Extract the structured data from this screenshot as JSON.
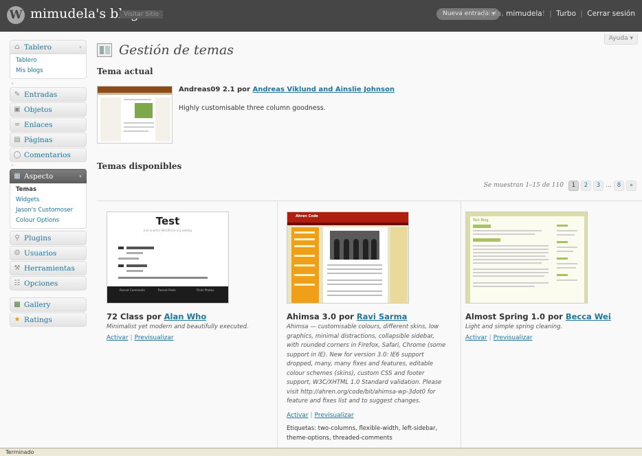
{
  "header": {
    "blog_title": "mimudela's blog",
    "visit_site": "Visitar Sitio",
    "new_entry": "Nueva entrada",
    "greeting": "¡Hola, ",
    "username": "mimudela",
    "greeting_end": "!",
    "turbo": "Turbo",
    "logout": "Cerrar sesión"
  },
  "help_tab": "Ayuda",
  "menu": {
    "tablero": "Tablero",
    "tablero_sub": [
      "Tablero",
      "Mis blogs"
    ],
    "entradas": "Entradas",
    "objetos": "Objetos",
    "enlaces": "Enlaces",
    "paginas": "Páginas",
    "comentarios": "Comentarios",
    "aspecto": "Aspecto",
    "aspecto_sub": [
      "Temas",
      "Widgets",
      "Jason's Customoser",
      "Colour Options"
    ],
    "plugins": "Plugins",
    "usuarios": "Usuarios",
    "herramientas": "Herramientas",
    "opciones": "Opciones",
    "gallery": "Gallery",
    "ratings": "Ratings"
  },
  "page": {
    "title": "Gestión de temas",
    "current_heading": "Tema actual",
    "current_theme_name": "Andreas09 2.1 por ",
    "current_theme_author": "Andreas Viklund and Ainslie Johnson",
    "current_theme_desc": "Highly customisable three column goodness.",
    "available_heading": "Temas disponibles",
    "paging_info": "Se muestran 1–15 de 110",
    "pages": [
      "1",
      "2",
      "3",
      "…",
      "8",
      "»"
    ],
    "activate": "Activar",
    "preview": "Previsualizar"
  },
  "themes": [
    {
      "name": "72 Class por ",
      "author": "Alan Who",
      "desc": "Minimalist yet modern and beautifully executed.",
      "shot_title": "Test",
      "shot_sub": "Just another WordPress.org weblog",
      "shot_footer": [
        "Recent Comments",
        "Recent Posts",
        "Flickr Photos"
      ]
    },
    {
      "name": "Ahimsa 3.0 por ",
      "author": "Ravi Sarma",
      "desc": "Ahimsa — customisable colours, different skins, low graphics, minimal distractions, collapsible sidebar, with rounded corners in Firefox, Safari, Chrome (some support in IE). New for version 3.0: IE6 support dropped, many, many fixes and features, editable colour schemes (skins), custom CSS and footer support, W3C/XHTML 1.0 Standard validation. Please visit http://ahren.org/code/bit/ahimsa-wp-3dot0 for feature and fixes list and to suggest changes.",
      "tags": "Etiquetas: two-columns, flexible-width, left-sidebar, theme-options, threaded-comments",
      "shot_title": "Ahren Code"
    },
    {
      "name": "Almost Spring 1.0 por ",
      "author": "Becca Wei",
      "desc": "Light and simple spring cleaning.",
      "shot_title": "Test Blog"
    }
  ],
  "statusbar": "Terminado"
}
